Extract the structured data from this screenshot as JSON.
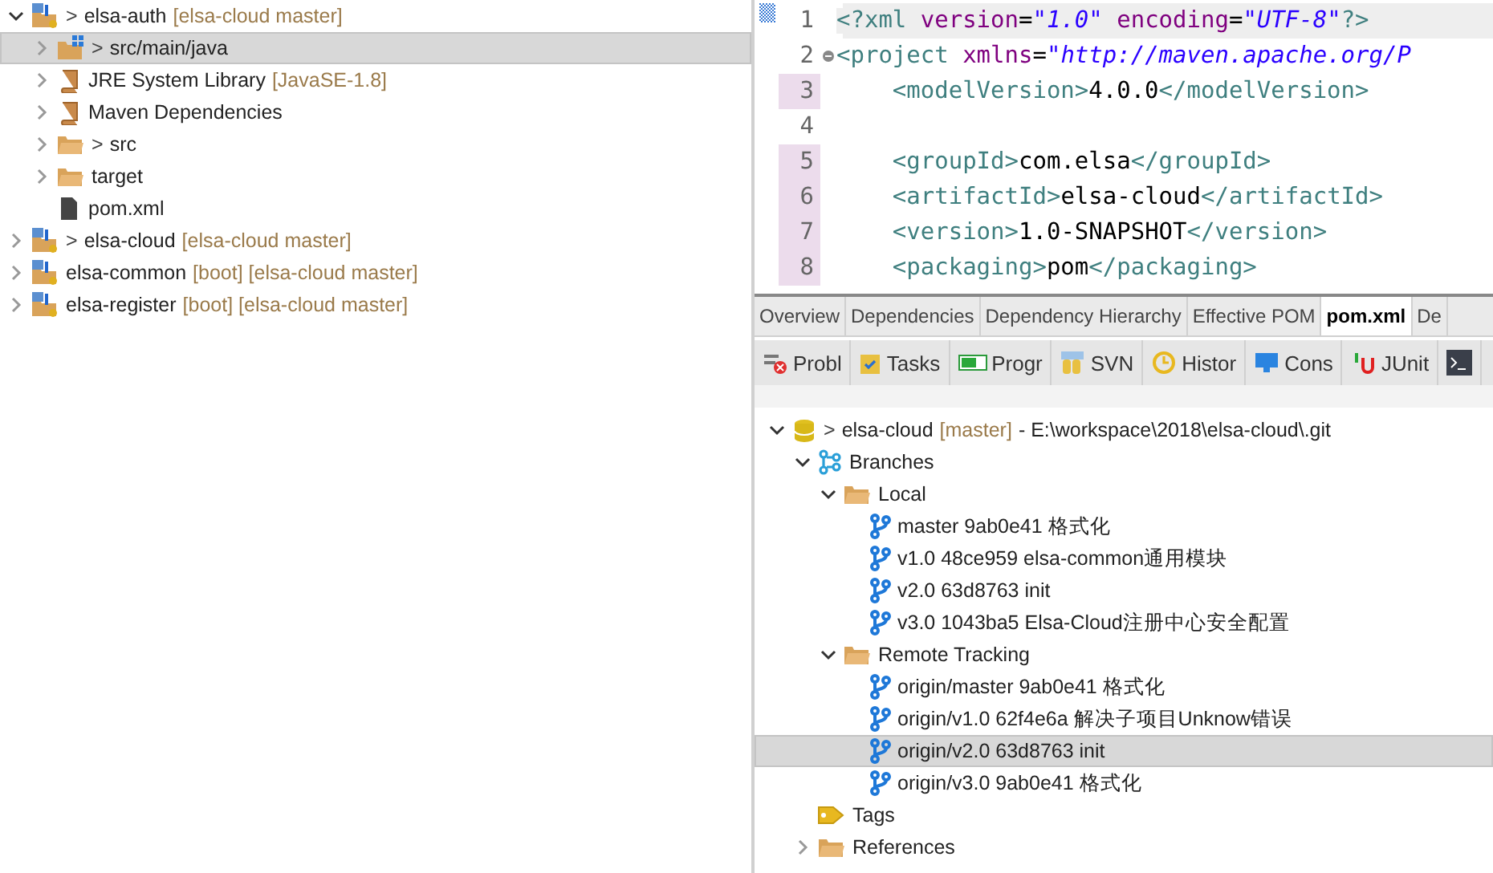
{
  "project_explorer": {
    "items": [
      {
        "kind": "maven-project",
        "prefix": ">",
        "label": "elsa-auth",
        "suffix": "[elsa-cloud master]",
        "expanded": true,
        "selected": false,
        "children": [
          {
            "kind": "source-folder",
            "prefix": ">",
            "label": "src/main/java",
            "expanded": false,
            "selected": true
          },
          {
            "kind": "library",
            "label": "JRE System Library",
            "suffix": "[JavaSE-1.8]",
            "expanded": false,
            "selected": false
          },
          {
            "kind": "library",
            "label": "Maven Dependencies",
            "expanded": false,
            "selected": false
          },
          {
            "kind": "folder-changed",
            "prefix": ">",
            "label": "src",
            "expanded": false,
            "selected": false
          },
          {
            "kind": "folder",
            "label": "target",
            "expanded": false,
            "selected": false
          },
          {
            "kind": "file",
            "label": "pom.xml",
            "selected": false
          }
        ]
      },
      {
        "kind": "maven-project",
        "prefix": ">",
        "label": "elsa-cloud",
        "suffix": "[elsa-cloud master]",
        "expanded": false,
        "selected": false
      },
      {
        "kind": "maven-project",
        "label": "elsa-common",
        "suffix": "[boot] [elsa-cloud master]",
        "expanded": false,
        "selected": false
      },
      {
        "kind": "maven-project",
        "label": "elsa-register",
        "suffix": "[boot] [elsa-cloud master]",
        "expanded": false,
        "selected": false
      }
    ]
  },
  "editor": {
    "lines": [
      {
        "number": "1",
        "changed": false,
        "current": true,
        "foldable": false,
        "tokens": [
          {
            "kind": "tag",
            "text": "<?xml"
          },
          {
            "kind": "attr",
            "text": " version"
          },
          {
            "kind": "text",
            "text": "="
          },
          {
            "kind": "string",
            "text": "\"1.0\""
          },
          {
            "kind": "attr",
            "text": " encoding"
          },
          {
            "kind": "text",
            "text": "="
          },
          {
            "kind": "string",
            "text": "\"UTF-8\""
          },
          {
            "kind": "tag",
            "text": "?>"
          }
        ]
      },
      {
        "number": "2",
        "changed": false,
        "current": false,
        "foldable": true,
        "tokens": [
          {
            "kind": "tag",
            "text": "<project"
          },
          {
            "kind": "attr",
            "text": " xmlns"
          },
          {
            "kind": "text",
            "text": "="
          },
          {
            "kind": "string",
            "text": "\"http://maven.apache.org/P"
          }
        ]
      },
      {
        "number": "3",
        "changed": true,
        "current": false,
        "foldable": false,
        "tokens": [
          {
            "kind": "tag",
            "text": "    <modelVersion>"
          },
          {
            "kind": "text",
            "text": "4.0.0"
          },
          {
            "kind": "tag",
            "text": "</modelVersion>"
          }
        ]
      },
      {
        "number": "4",
        "changed": false,
        "current": false,
        "foldable": false
      },
      {
        "number": "5",
        "changed": true,
        "current": false,
        "foldable": false,
        "tokens": [
          {
            "kind": "tag",
            "text": "    <groupId>"
          },
          {
            "kind": "text",
            "text": "com.elsa"
          },
          {
            "kind": "tag",
            "text": "</groupId>"
          }
        ]
      },
      {
        "number": "6",
        "changed": true,
        "current": false,
        "foldable": false,
        "tokens": [
          {
            "kind": "tag",
            "text": "    <artifactId>"
          },
          {
            "kind": "text",
            "text": "elsa-cloud"
          },
          {
            "kind": "tag",
            "text": "</artifactId>"
          }
        ]
      },
      {
        "number": "7",
        "changed": true,
        "current": false,
        "foldable": false,
        "tokens": [
          {
            "kind": "tag",
            "text": "    <version>"
          },
          {
            "kind": "text",
            "text": "1.0-SNAPSHOT"
          },
          {
            "kind": "tag",
            "text": "</version>"
          }
        ]
      },
      {
        "number": "8",
        "changed": true,
        "current": false,
        "foldable": false,
        "tokens": [
          {
            "kind": "tag",
            "text": "    <packaging>"
          },
          {
            "kind": "text",
            "text": "pom"
          },
          {
            "kind": "tag",
            "text": "</packaging>"
          }
        ]
      }
    ]
  },
  "editor_tabs": [
    {
      "label": "Overview",
      "selected": false
    },
    {
      "label": "Dependencies",
      "selected": false
    },
    {
      "label": "Dependency Hierarchy",
      "selected": false
    },
    {
      "label": "Effective POM",
      "selected": false
    },
    {
      "label": "pom.xml",
      "selected": true
    },
    {
      "label": "De",
      "selected": false
    }
  ],
  "view_tabs": [
    {
      "kind": "problems",
      "label": "Probl"
    },
    {
      "kind": "tasks",
      "label": "Tasks"
    },
    {
      "kind": "progress",
      "label": "Progr"
    },
    {
      "kind": "svn",
      "label": "SVN"
    },
    {
      "kind": "history",
      "label": "Histor"
    },
    {
      "kind": "console",
      "label": "Cons"
    },
    {
      "kind": "junit",
      "label": "JUnit"
    },
    {
      "kind": "terminal"
    }
  ],
  "git_repositories": {
    "items": [
      {
        "kind": "repository",
        "prefix": ">",
        "label": "elsa-cloud",
        "suffix": "[master]",
        "detail": "- E:\\workspace\\2018\\elsa-cloud\\.git",
        "expanded": true,
        "selected": false,
        "children": [
          {
            "kind": "branches",
            "label": "Branches",
            "expanded": true,
            "selected": false,
            "children": [
              {
                "kind": "folder",
                "label": "Local",
                "expanded": true,
                "selected": false,
                "children": [
                  {
                    "kind": "branch",
                    "label": "master 9ab0e41 格式化",
                    "selected": false
                  },
                  {
                    "kind": "branch",
                    "label": "v1.0 48ce959 elsa-common通用模块",
                    "selected": false
                  },
                  {
                    "kind": "branch",
                    "label": "v2.0 63d8763 init",
                    "selected": false
                  },
                  {
                    "kind": "branch",
                    "label": "v3.0 1043ba5 Elsa-Cloud注册中心安全配置",
                    "selected": false
                  }
                ]
              },
              {
                "kind": "folder",
                "label": "Remote Tracking",
                "expanded": true,
                "selected": false,
                "children": [
                  {
                    "kind": "branch",
                    "label": "origin/master 9ab0e41 格式化",
                    "selected": false
                  },
                  {
                    "kind": "branch",
                    "label": "origin/v1.0 62f4e6a 解决子项目Unknow错误",
                    "selected": false
                  },
                  {
                    "kind": "branch",
                    "label": "origin/v2.0 63d8763 init",
                    "selected": true
                  },
                  {
                    "kind": "branch",
                    "label": "origin/v3.0 9ab0e41 格式化",
                    "selected": false
                  }
                ]
              }
            ]
          },
          {
            "kind": "tags",
            "label": "Tags",
            "selected": false
          },
          {
            "kind": "folder",
            "label": "References",
            "expanded": false,
            "selected": false
          }
        ]
      }
    ]
  }
}
